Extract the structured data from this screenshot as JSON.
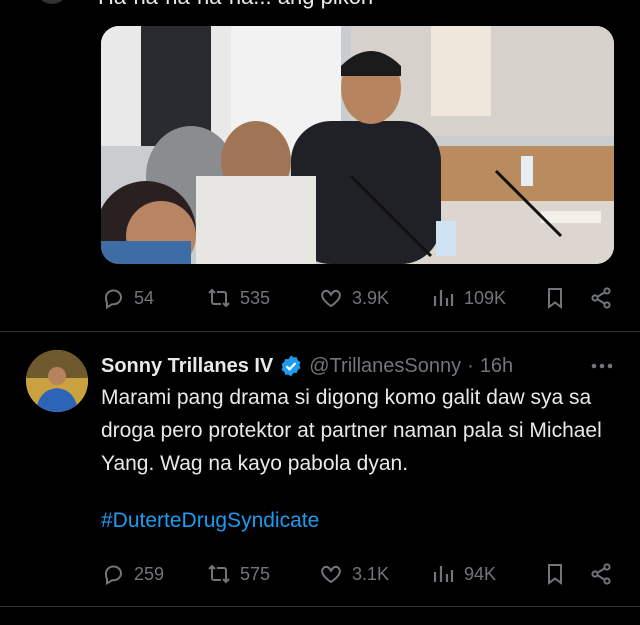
{
  "previous_tweet": {
    "cut_text": "Ha-ha-ha-ha-ha... ang pikon",
    "actions": {
      "replies": "54",
      "reposts": "535",
      "likes": "3.9K",
      "views": "109K"
    }
  },
  "tweet": {
    "author_name": "Sonny Trillanes IV",
    "handle": "@TrillanesSonny",
    "separator": "·",
    "time": "16h",
    "text": "Marami pang drama si digong komo galit daw sya sa droga pero protektor at partner naman pala si Michael Yang. Wag na kayo pabola dyan.",
    "hashtag": "#DuterteDrugSyndicate",
    "actions": {
      "replies": "259",
      "reposts": "575",
      "likes": "3.1K",
      "views": "94K"
    }
  },
  "colors": {
    "background": "#000000",
    "text": "#e7e9ea",
    "muted": "#71767b",
    "accent": "#1d9bf0",
    "divider": "#2f3336"
  },
  "icons": [
    "reply-icon",
    "repost-icon",
    "like-icon",
    "views-icon",
    "bookmark-icon",
    "share-icon",
    "verified-badge-icon",
    "more-icon"
  ]
}
